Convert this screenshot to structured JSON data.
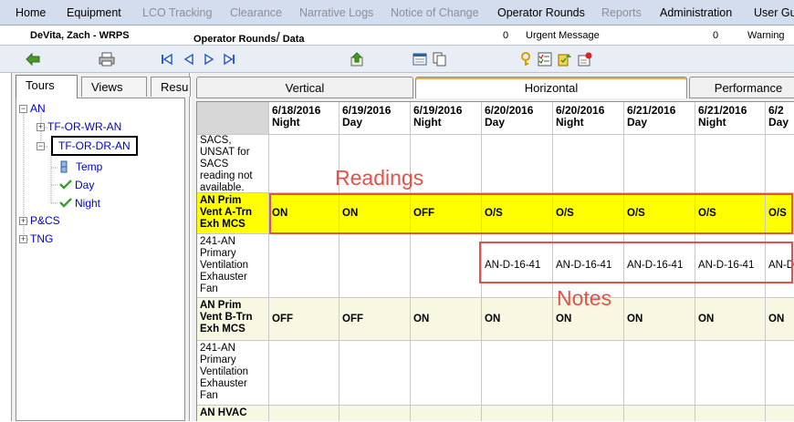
{
  "menu": [
    {
      "label": "Home",
      "enabled": true
    },
    {
      "label": "Equipment",
      "enabled": true
    },
    {
      "label": "LCO Tracking",
      "enabled": false
    },
    {
      "label": "Clearance",
      "enabled": false
    },
    {
      "label": "Narrative Logs",
      "enabled": false
    },
    {
      "label": "Notice of Change",
      "enabled": false
    },
    {
      "label": "Operator Rounds",
      "enabled": true
    },
    {
      "label": "Reports",
      "enabled": false
    },
    {
      "label": "Administration",
      "enabled": true
    },
    {
      "label": "User Gui",
      "enabled": true
    }
  ],
  "userbar": {
    "user": "DeVita, Zach - WRPS",
    "module_prefix": "Operator Rounds",
    "module_suffix": "Data",
    "urgent_count": "0",
    "urgent_label": "Urgent Message",
    "warning_count": "0",
    "warning_label": "Warning"
  },
  "toolbar_icons": [
    "back-arrow-icon",
    "print-icon",
    "first-record-icon",
    "previous-record-icon",
    "next-record-icon",
    "last-record-icon",
    "upload-icon",
    "form-view-icon",
    "copy-icon",
    "key-icon",
    "checklist-icon",
    "assign-icon",
    "alert-icon"
  ],
  "left_tabs": [
    "Tours",
    "Views",
    "Resu"
  ],
  "tree": {
    "root": "AN",
    "children": [
      "TF-OR-WR-AN",
      "TF-OR-DR-AN"
    ],
    "grandchildren": [
      "Temp",
      "Day",
      "Night"
    ],
    "siblings": [
      "P&CS",
      "TNG"
    ]
  },
  "right_tabs": [
    "Vertical",
    "Horizontal",
    "Performance"
  ],
  "grid": {
    "columns": [
      {
        "date": "6/18/2016",
        "shift": "Night"
      },
      {
        "date": "6/19/2016",
        "shift": "Day"
      },
      {
        "date": "6/19/2016",
        "shift": "Night"
      },
      {
        "date": "6/20/2016",
        "shift": "Day"
      },
      {
        "date": "6/20/2016",
        "shift": "Night"
      },
      {
        "date": "6/21/2016",
        "shift": "Day"
      },
      {
        "date": "6/21/2016",
        "shift": "Night"
      },
      {
        "date": "6/2",
        "shift": "Day"
      }
    ],
    "rows": [
      {
        "label": "SACS, UNSAT for SACS reading not available.",
        "values": [
          "",
          "",
          "",
          "",
          "",
          "",
          "",
          ""
        ]
      },
      {
        "label": "AN Prim Vent A-Trn Exh MCS",
        "values": [
          "ON",
          "ON",
          "OFF",
          "O/S",
          "O/S",
          "O/S",
          "O/S",
          "O/S"
        ]
      },
      {
        "label": "241-AN Primary Ventilation Exhauster Fan",
        "values": [
          "",
          "",
          "",
          "AN-D-16-41",
          "AN-D-16-41",
          "AN-D-16-41",
          "AN-D-16-41",
          "AN-D"
        ]
      },
      {
        "label": "AN Prim Vent B-Trn Exh MCS",
        "values": [
          "OFF",
          "OFF",
          "ON",
          "ON",
          "ON",
          "ON",
          "ON",
          "ON"
        ]
      },
      {
        "label": "241-AN Primary Ventilation Exhauster Fan",
        "values": [
          "",
          "",
          "",
          "",
          "",
          "",
          "",
          ""
        ]
      },
      {
        "label": "AN HVAC",
        "values": [
          "",
          "",
          "",
          "",
          "",
          "",
          "",
          ""
        ]
      }
    ]
  },
  "annotations": {
    "readings": "Readings",
    "notes": "Notes"
  },
  "colors": {
    "highlight": "#ffff00",
    "annotation": "#e0524a",
    "tab_accent": "#f4a742",
    "tree_link": "#0000cc",
    "alt_row": "#f7f7e2"
  }
}
